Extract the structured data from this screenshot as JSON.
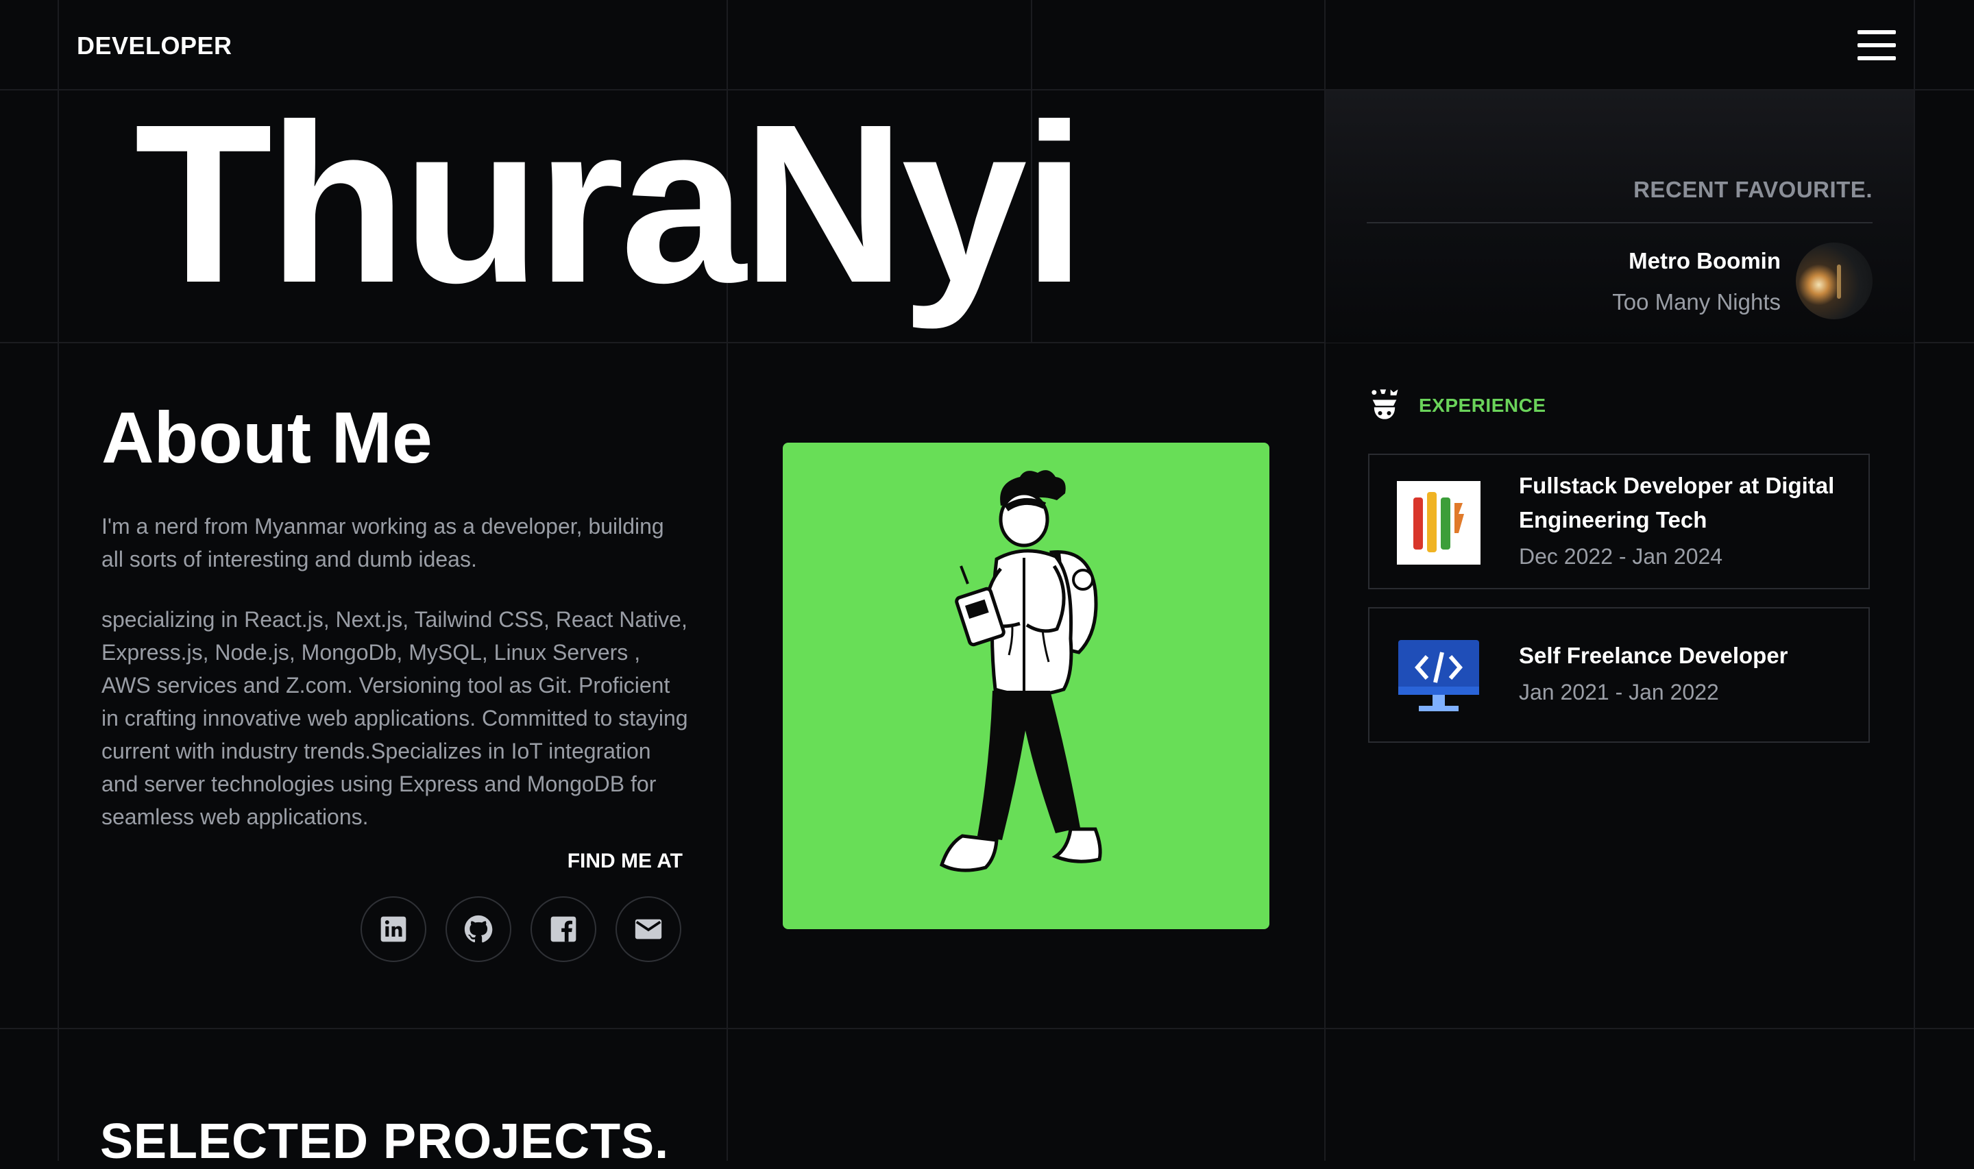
{
  "nav": {
    "brand": "DEVELOPER",
    "menu_icon": "hamburger-menu-icon"
  },
  "hero": {
    "name": "ThuraNyi"
  },
  "recent_favourite": {
    "title": "RECENT FAVOURITE.",
    "artist": "Metro Boomin",
    "song": "Too Many Nights"
  },
  "about": {
    "title": "About Me",
    "intro": "I'm a nerd from Myanmar working as a developer, building all sorts of interesting and dumb ideas.",
    "details": "specializing in React.js, Next.js, Tailwind CSS, React Native, Express.js, Node.js, MongoDb, MySQL, Linux Servers , AWS services and Z.com. Versioning tool as Git. Proficient in crafting innovative web applications. Committed to staying current with industry trends.Specializes in IoT integration and server technologies using Express and MongoDB for seamless web applications.",
    "find_me": "FIND ME AT",
    "socials": [
      {
        "icon": "linkedin-icon"
      },
      {
        "icon": "github-icon"
      },
      {
        "icon": "facebook-icon"
      },
      {
        "icon": "email-icon"
      }
    ]
  },
  "experience": {
    "title": "EXPERIENCE",
    "items": [
      {
        "role": "Fullstack Developer at Digital Engineering Tech",
        "dates": "Dec 2022 - Jan 2024",
        "logo": "digital-engineering-tech-logo"
      },
      {
        "role": "Self Freelance Developer",
        "dates": "Jan 2021 - Jan 2022",
        "logo": "code-monitor-icon"
      }
    ]
  },
  "projects": {
    "title": "SELECTED PROJECTS."
  },
  "colors": {
    "background": "#08090b",
    "accent_green": "#68de57",
    "muted_text": "#9a9ea6",
    "grid_line": "#1b1c20"
  }
}
